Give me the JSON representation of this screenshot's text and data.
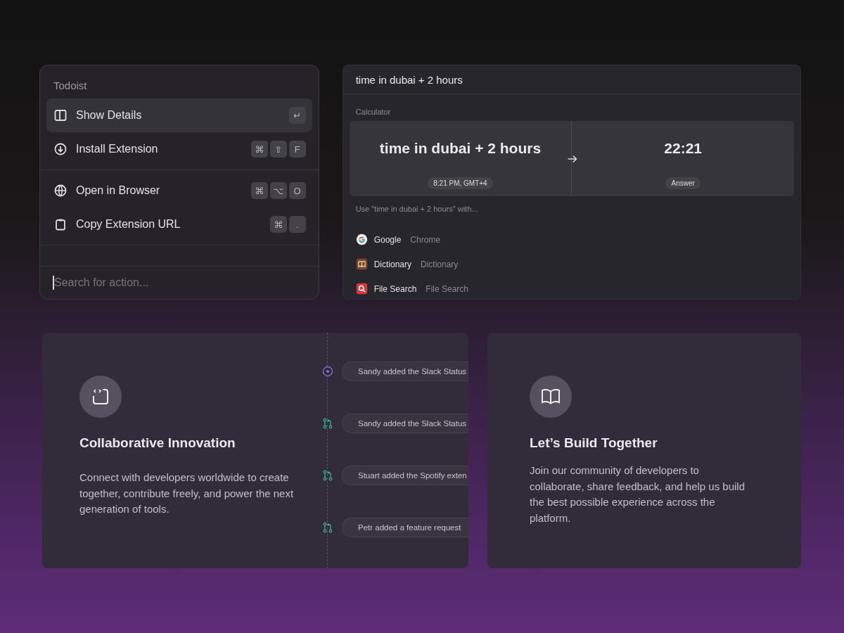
{
  "actions_panel": {
    "title": "Todoist",
    "items": [
      {
        "kind": "details",
        "label": "Show Details",
        "selected": true,
        "keys": [
          "↵"
        ]
      },
      {
        "kind": "install",
        "label": "Install Extension",
        "selected": false,
        "keys": [
          "⌘",
          "⇧",
          "F"
        ]
      },
      {
        "kind": "browser",
        "label": "Open in Browser",
        "selected": false,
        "keys": [
          "⌘",
          "⌥",
          "O"
        ]
      },
      {
        "kind": "copy",
        "label": "Copy Extension URL",
        "selected": false,
        "keys": [
          "⌘",
          "."
        ]
      }
    ],
    "search": {
      "placeholder": "Search for action..."
    }
  },
  "calculator_panel": {
    "query": "time in dubai + 2 hours",
    "section": "Calculator",
    "expression": "time in dubai + 2 hours",
    "expression_note": "8:21 PM, GMT+4",
    "result": "22:21",
    "result_note": "Answer",
    "use_with": "Use \"time in dubai + 2 hours\" with...",
    "apps": [
      {
        "kind": "google",
        "name": "Google",
        "source": "Chrome"
      },
      {
        "kind": "dictionary",
        "name": "Dictionary",
        "source": "Dictionary"
      },
      {
        "kind": "file-search",
        "name": "File Search",
        "source": "File Search"
      }
    ]
  },
  "collab_card": {
    "title": "Collaborative Innovation",
    "text": "Connect with developers worldwide to create together, contribute freely, and power the next generation of tools.",
    "timeline": [
      {
        "kind": "dot",
        "text": "Sandy added the Slack Status"
      },
      {
        "kind": "merge",
        "text": "Sandy added the Slack Status"
      },
      {
        "kind": "merge",
        "text": "Stuart added the Spotify exten"
      },
      {
        "kind": "merge",
        "text": "Petr added a feature request"
      }
    ]
  },
  "build_card": {
    "title": "Let’s Build Together",
    "text": "Join our community of developers to collaborate, share feedback, and help us build the best possible experience across the platform."
  }
}
